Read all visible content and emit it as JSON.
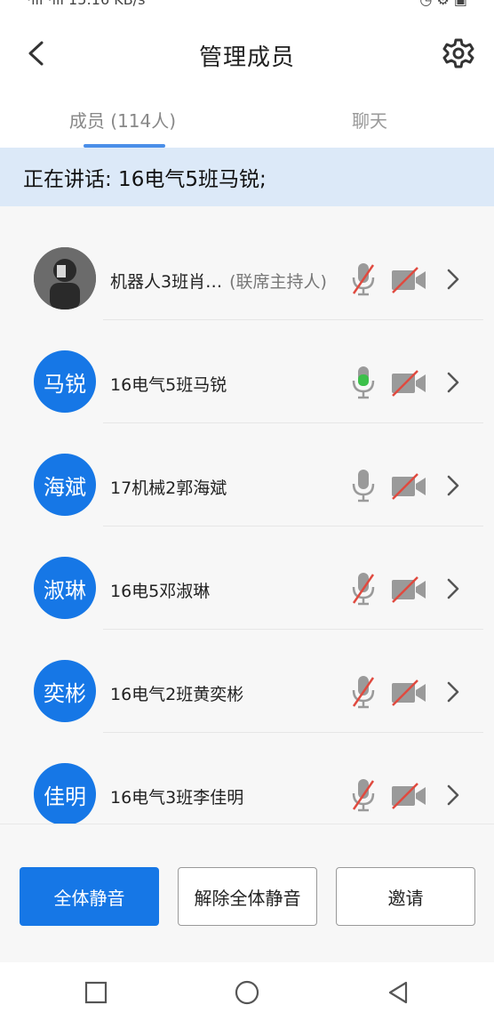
{
  "status": {
    "left": "·ıll ·ıll 15:16 KB/s",
    "right": "◷ ⚙ ▣"
  },
  "header": {
    "title": "管理成员",
    "back_icon": "chevron-left-icon",
    "settings_icon": "gear-icon"
  },
  "tabs": {
    "members": "成员 (114人)",
    "chat": "聊天",
    "active": "members"
  },
  "speaking": "正在讲话: 16电气5班马锐;",
  "members": [
    {
      "avatar_text": "",
      "avatar_type": "photo",
      "name": "机器人3班肖…",
      "role": "(联席主持人)",
      "mic": "muted",
      "camera": "off"
    },
    {
      "avatar_text": "马锐",
      "avatar_type": "text",
      "name": "16电气5班马锐",
      "role": "",
      "mic": "speaking",
      "camera": "off"
    },
    {
      "avatar_text": "海斌",
      "avatar_type": "text",
      "name": "17机械2郭海斌",
      "role": "",
      "mic": "on",
      "camera": "off"
    },
    {
      "avatar_text": "淑琳",
      "avatar_type": "text",
      "name": "16电5邓淑琳",
      "role": "",
      "mic": "muted",
      "camera": "off"
    },
    {
      "avatar_text": "奕彬",
      "avatar_type": "text",
      "name": "16电气2班黄奕彬",
      "role": "",
      "mic": "muted",
      "camera": "off"
    },
    {
      "avatar_text": "佳明",
      "avatar_type": "text",
      "name": "16电气3班李佳明",
      "role": "",
      "mic": "muted",
      "camera": "off"
    }
  ],
  "actions": {
    "mute_all": "全体静音",
    "unmute_all": "解除全体静音",
    "invite": "邀请"
  },
  "colors": {
    "accent": "#1677e6",
    "speaking_bg": "#dce9f8",
    "muted_red": "#e04a3f",
    "speaking_green": "#3cc04a",
    "icon_gray": "#9a9a9a"
  },
  "navbar": {
    "recent_icon": "square-icon",
    "home_icon": "circle-icon",
    "back_icon": "triangle-back-icon"
  }
}
